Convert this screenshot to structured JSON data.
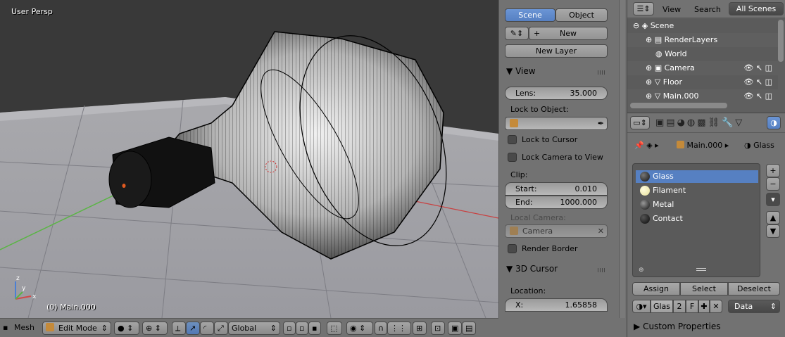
{
  "viewport": {
    "view_name": "User Persp",
    "object_info": "(0) Main.000"
  },
  "toolbar": {
    "mesh_menu": "Mesh",
    "mode": "Edit Mode",
    "orientation": "Global"
  },
  "properties_panel": {
    "tabs": [
      "Scene",
      "Object"
    ],
    "active_tab": "Scene",
    "new_button": "New",
    "new_layer_button": "New Layer",
    "view_section": {
      "title": "View",
      "lens_label": "Lens:",
      "lens_value": "35.000",
      "lock_to_object_label": "Lock to Object:",
      "lock_to_cursor": "Lock to Cursor",
      "lock_camera_to_view": "Lock Camera to View",
      "clip_label": "Clip:",
      "start_label": "Start:",
      "start_value": "0.010",
      "end_label": "End:",
      "end_value": "1000.000",
      "local_camera_label": "Local Camera:",
      "camera_value": "Camera",
      "render_border": "Render Border"
    },
    "cursor_section": {
      "title": "3D Cursor",
      "location_label": "Location:",
      "x_label": "X:",
      "x_value": "1.65858"
    }
  },
  "outliner": {
    "view_menu": "View",
    "search_menu": "Search",
    "filter": "All Scenes",
    "items": [
      {
        "name": "Scene",
        "icon": "scene-icon"
      },
      {
        "name": "RenderLayers",
        "icon": "renderlayers-icon"
      },
      {
        "name": "World",
        "icon": "world-icon"
      },
      {
        "name": "Camera",
        "icon": "camera-icon"
      },
      {
        "name": "Floor",
        "icon": "mesh-icon"
      },
      {
        "name": "Main.000",
        "icon": "mesh-icon"
      }
    ]
  },
  "material_editor": {
    "breadcrumb_object": "Main.000",
    "breadcrumb_material": "Glass",
    "slots": [
      {
        "name": "Glass",
        "color": "#2a2a2a"
      },
      {
        "name": "Filament",
        "color": "#f2eeb0"
      },
      {
        "name": "Metal",
        "color": "#333333"
      },
      {
        "name": "Contact",
        "color": "#222222"
      }
    ],
    "assign_button": "Assign",
    "select_button": "Select",
    "deselect_button": "Deselect",
    "material_name": "Glas",
    "users_count": "2",
    "fake_user": "F",
    "link_mode": "Data",
    "custom_properties": "Custom Properties"
  },
  "colors": {
    "accent": "#5680c2",
    "panel_bg": "#727272",
    "viewport_bg": "#393939"
  }
}
